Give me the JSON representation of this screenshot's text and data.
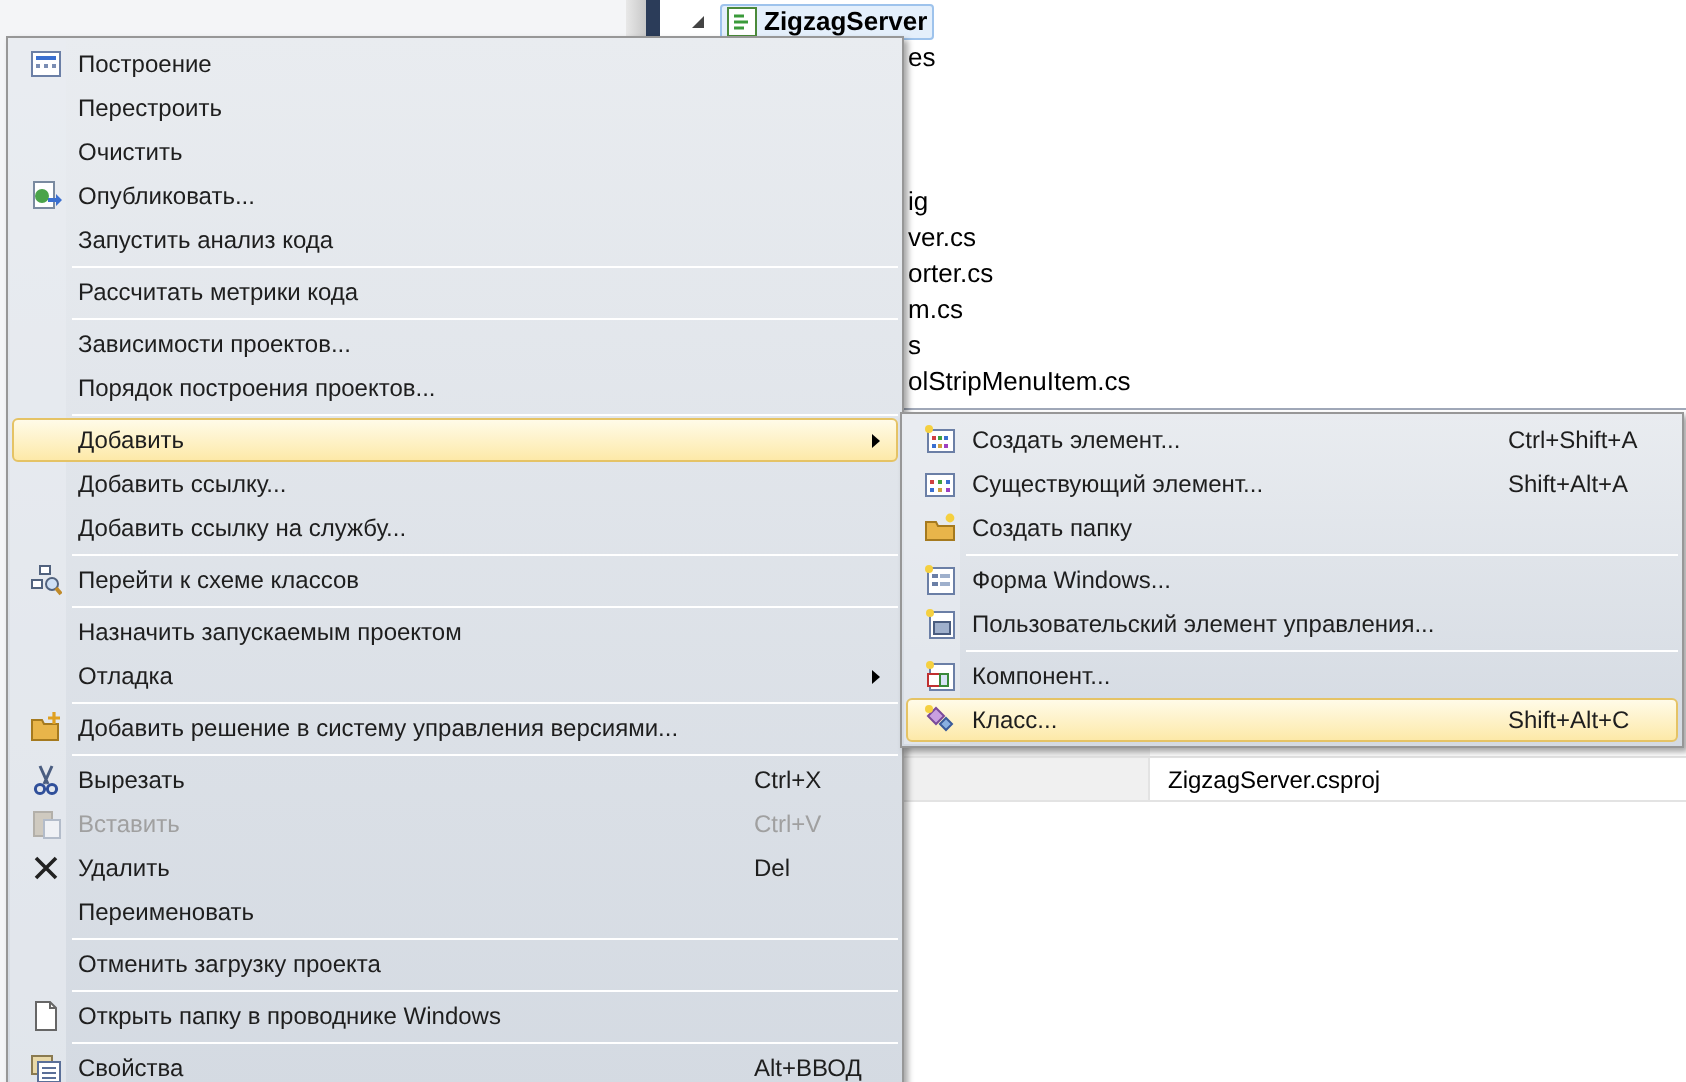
{
  "solution_explorer": {
    "root": {
      "label": "ZigzagServer",
      "selected": true,
      "expanded": true
    },
    "rows": [
      "es",
      "ig",
      "ver.cs",
      "orter.cs",
      "m.cs",
      "s",
      "olStripMenuItem.cs"
    ]
  },
  "properties_grid": {
    "file_name": "ZigzagServer.csproj"
  },
  "context_menu": {
    "items": [
      {
        "kind": "item",
        "label": "Построение",
        "selected": false,
        "disabled": false,
        "submenu": false
      },
      {
        "kind": "item",
        "label": "Перестроить",
        "selected": false,
        "disabled": false,
        "submenu": false
      },
      {
        "kind": "item",
        "label": "Очистить",
        "selected": false,
        "disabled": false,
        "submenu": false
      },
      {
        "kind": "item",
        "label": "Опубликовать...",
        "selected": false,
        "disabled": false,
        "submenu": false
      },
      {
        "kind": "item",
        "label": "Запустить анализ кода",
        "selected": false,
        "disabled": false,
        "submenu": false
      },
      {
        "kind": "separator"
      },
      {
        "kind": "item",
        "label": "Рассчитать метрики кода",
        "selected": false,
        "disabled": false,
        "submenu": false
      },
      {
        "kind": "separator"
      },
      {
        "kind": "item",
        "label": "Зависимости проектов...",
        "selected": false,
        "disabled": false,
        "submenu": false
      },
      {
        "kind": "item",
        "label": "Порядок построения проектов...",
        "selected": false,
        "disabled": false,
        "submenu": false
      },
      {
        "kind": "separator"
      },
      {
        "kind": "item",
        "label": "Добавить",
        "selected": true,
        "disabled": false,
        "submenu": true
      },
      {
        "kind": "item",
        "label": "Добавить ссылку...",
        "selected": false,
        "disabled": false,
        "submenu": false
      },
      {
        "kind": "item",
        "label": "Добавить ссылку на службу...",
        "selected": false,
        "disabled": false,
        "submenu": false
      },
      {
        "kind": "separator"
      },
      {
        "kind": "item",
        "label": "Перейти к схеме классов",
        "selected": false,
        "disabled": false,
        "submenu": false
      },
      {
        "kind": "separator"
      },
      {
        "kind": "item",
        "label": "Назначить запускаемым проектом",
        "selected": false,
        "disabled": false,
        "submenu": false
      },
      {
        "kind": "item",
        "label": "Отладка",
        "selected": false,
        "disabled": false,
        "submenu": true
      },
      {
        "kind": "separator"
      },
      {
        "kind": "item",
        "label": "Добавить решение в систему управления версиями...",
        "selected": false,
        "disabled": false,
        "submenu": false
      },
      {
        "kind": "separator"
      },
      {
        "kind": "item",
        "label": "Вырезать",
        "shortcut": "Ctrl+X",
        "selected": false,
        "disabled": false,
        "submenu": false
      },
      {
        "kind": "item",
        "label": "Вставить",
        "shortcut": "Ctrl+V",
        "selected": false,
        "disabled": true,
        "submenu": false
      },
      {
        "kind": "item",
        "label": "Удалить",
        "shortcut": "Del",
        "selected": false,
        "disabled": false,
        "submenu": false
      },
      {
        "kind": "item",
        "label": "Переименовать",
        "selected": false,
        "disabled": false,
        "submenu": false
      },
      {
        "kind": "separator"
      },
      {
        "kind": "item",
        "label": "Отменить загрузку проекта",
        "selected": false,
        "disabled": false,
        "submenu": false
      },
      {
        "kind": "separator"
      },
      {
        "kind": "item",
        "label": "Открыть папку в проводнике Windows",
        "selected": false,
        "disabled": false,
        "submenu": false
      },
      {
        "kind": "separator"
      },
      {
        "kind": "item",
        "label": "Свойства",
        "shortcut": "Alt+ВВОД",
        "selected": false,
        "disabled": false,
        "submenu": false
      }
    ]
  },
  "add_submenu": {
    "items": [
      {
        "kind": "item",
        "label": "Создать элемент...",
        "shortcut": "Ctrl+Shift+A",
        "selected": false,
        "disabled": false,
        "submenu": false
      },
      {
        "kind": "item",
        "label": "Существующий элемент...",
        "shortcut": "Shift+Alt+A",
        "selected": false,
        "disabled": false,
        "submenu": false
      },
      {
        "kind": "item",
        "label": "Создать папку",
        "selected": false,
        "disabled": false,
        "submenu": false
      },
      {
        "kind": "separator"
      },
      {
        "kind": "item",
        "label": "Форма Windows...",
        "selected": false,
        "disabled": false,
        "submenu": false
      },
      {
        "kind": "item",
        "label": "Пользовательский элемент управления...",
        "selected": false,
        "disabled": false,
        "submenu": false
      },
      {
        "kind": "separator"
      },
      {
        "kind": "item",
        "label": "Компонент...",
        "selected": false,
        "disabled": false,
        "submenu": false
      },
      {
        "kind": "item",
        "label": "Класс...",
        "shortcut": "Shift+Alt+C",
        "selected": true,
        "disabled": false,
        "submenu": false
      }
    ]
  }
}
